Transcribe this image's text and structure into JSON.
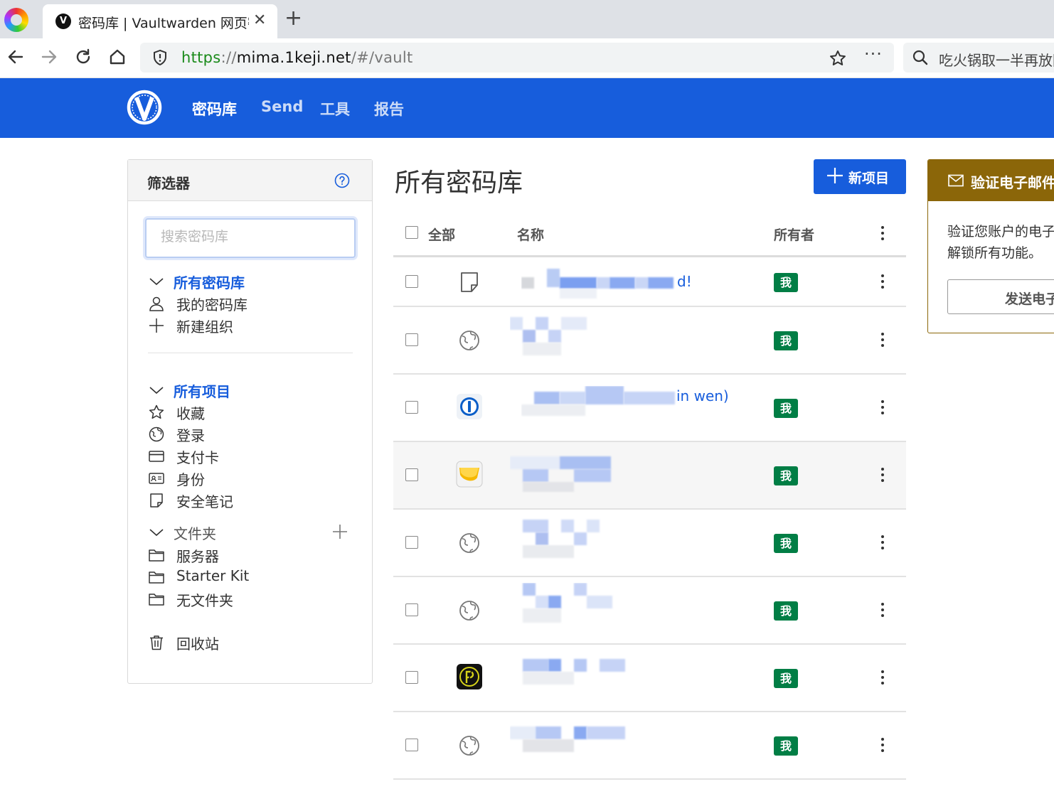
{
  "browser": {
    "tab_title": "密码库 | Vaultwarden 网页密码库",
    "tab_favicon": "V",
    "url_scheme": "https",
    "url_sep": "://",
    "url_host": "mima.1keji.net",
    "url_path": "/#/vault",
    "search_text": "吃火锅取一半再放回"
  },
  "nav": {
    "vault": "密码库",
    "send": "Send",
    "tools": "工具",
    "reports": "报告"
  },
  "filters": {
    "title": "筛选器",
    "search_placeholder": "搜索密码库",
    "vaults_header": "所有密码库",
    "my_vault": "我的密码库",
    "new_org": "新建组织",
    "items_header": "所有项目",
    "favorites": "收藏",
    "login": "登录",
    "card": "支付卡",
    "identity": "身份",
    "secure_note": "安全笔记",
    "folders_header": "文件夹",
    "folders": [
      "服务器",
      "Starter Kit",
      "无文件夹"
    ],
    "trash": "回收站"
  },
  "main": {
    "title": "所有密码库",
    "new_item": "新项目",
    "col_all": "全部",
    "col_name": "名称",
    "col_owner": "所有者"
  },
  "items": [
    {
      "type": "note-icon",
      "name_visible": "d!",
      "owner": "我"
    },
    {
      "type": "globe-icon",
      "name_visible": "",
      "owner": "我"
    },
    {
      "type": "onepassword-icon",
      "name_visible": "in wen)",
      "owner": "我"
    },
    {
      "type": "folder-app-icon",
      "name_visible": "",
      "owner": "我"
    },
    {
      "type": "globe-icon",
      "name_visible": "",
      "owner": "我"
    },
    {
      "type": "globe-icon",
      "name_visible": "",
      "owner": "我"
    },
    {
      "type": "passbolt-icon",
      "name_visible": "",
      "owner": "我"
    },
    {
      "type": "globe-icon",
      "name_visible": "",
      "owner": "我"
    }
  ],
  "warning": {
    "title": "验证电子邮件",
    "line1": "验证您账户的电子邮件",
    "line2": "解锁所有功能。",
    "button": "发送电子邮件"
  },
  "colors": {
    "brand": "#175ddc",
    "owner_badge": "#017e45",
    "warning": "#8b6609"
  }
}
